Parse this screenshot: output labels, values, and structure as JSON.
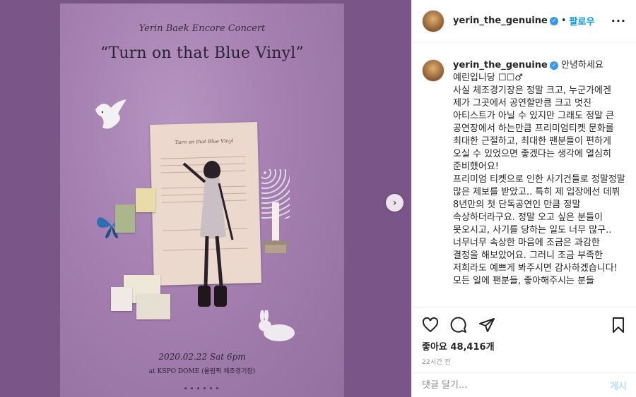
{
  "poster": {
    "subtitle": "Yerin Baek Encore Concert",
    "title": "“Turn on that Blue Vinyl”",
    "paper_title": "Turn on that Blue Vinyl",
    "date": "2020.02.22  Sat  6pm",
    "venue": "at KSPO DOME (올림픽 체조경기장)"
  },
  "header": {
    "username": "yerin_the_genuine",
    "follow_label": "팔로우"
  },
  "caption": {
    "username": "yerin_the_genuine",
    "text": "안녕하세요 예린입니당 ☐☐♂\n사실 체조경기장은 정말 크고, 누군가에겐 제가 그곳에서 공연할만큼 크고 멋진 아티스트가 아닐 수 있지만 그래도 정말 큰 공연장에서 하는만큼 프리미엄티켓 문화를 최대한 근절하고, 최대한 팬분들이 편하게 오실 수 있었으면 좋겠다는 생각에 열심히 준비했어요!\n프리미엄 티켓으로 인한 사기건들로 정말정말 많은 제보를 받았고.. 특히 제 입장에선 데뷔 8년만의 첫 단독공연인 만큼 정말 속상하더라구요. 정말 오고 싶은 분들이 못오시고, 사기를 당하는 일도 너무 많구.. 너무너무 속상한 마음에 조금은 과감한 결정을 해보았어요. 그러니 조금 부족한 저희라도 예쁘게 봐주시면 감사하겠습니다!\n모든 일에 팬분들, 좋아해주시는 분들"
  },
  "likes_text": "좋아요 48,416개",
  "time_text": "22시간 전",
  "comment": {
    "placeholder": "댓글 달기...",
    "post_label": "게시"
  },
  "colors": {
    "background": "#7a5587",
    "accent": "#0095f6",
    "verified": "#3897f0"
  }
}
